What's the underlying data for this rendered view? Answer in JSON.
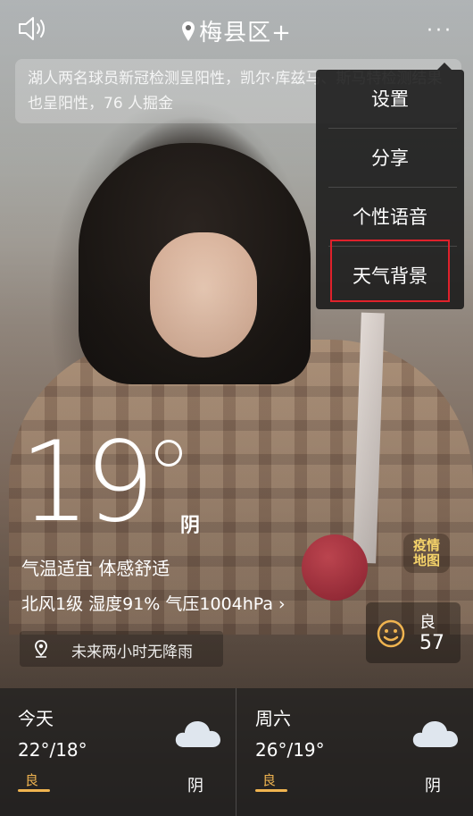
{
  "header": {
    "city": "梅县区",
    "add_symbol": "+",
    "more_symbol": "···"
  },
  "news": {
    "text": "湖人两名球员新冠检测呈阳性，凯尔·库兹马、斯马特检测结果也呈阳性，76 人掘金"
  },
  "menu": {
    "items": [
      "设置",
      "分享",
      "个性语音",
      "天气背景"
    ],
    "highlighted": "天气背景"
  },
  "current": {
    "temperature": "19",
    "condition": "阴",
    "comfort": "气温适宜 体感舒适",
    "details": "北风1级 湿度91% 气压1004hPa",
    "details_chevron": "›",
    "rain_note": "未来两小时无降雨"
  },
  "epidemic_map": {
    "line1": "疫情",
    "line2": "地图"
  },
  "aqi": {
    "level": "良",
    "value": "57"
  },
  "forecast": [
    {
      "day": "今天",
      "temp": "22°/18°",
      "aq": "良",
      "condition": "阴"
    },
    {
      "day": "周六",
      "temp": "26°/19°",
      "aq": "良",
      "condition": "阴"
    }
  ],
  "colors": {
    "aq_good": "#f0b450",
    "epidemic_text": "#f5d36a",
    "highlight_border": "#e0212b",
    "menu_bg": "#181818"
  }
}
